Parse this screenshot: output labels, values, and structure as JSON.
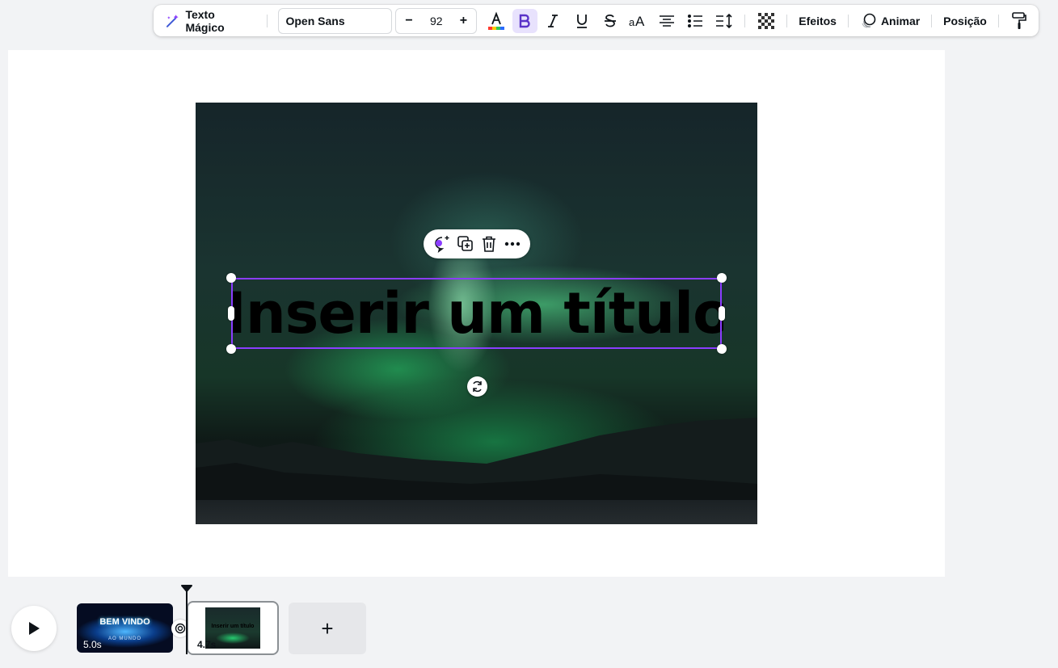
{
  "toolbar": {
    "magic_text_label": "Texto Mágico",
    "font_family_value": "Open Sans",
    "font_size_minus": "−",
    "font_size_value": "92",
    "font_size_plus": "+",
    "effects_label": "Efeitos",
    "animate_label": "Animar",
    "position_label": "Posição",
    "icons": [
      "magic-wand-icon",
      "text-color-icon",
      "bold-icon",
      "italic-icon",
      "underline-icon",
      "strikethrough-icon",
      "letter-case-icon",
      "align-center-icon",
      "list-icon",
      "spacing-icon",
      "transparency-icon",
      "animate-icon",
      "paint-roller-icon"
    ]
  },
  "canvas": {
    "title_text": "Inserir um título",
    "context_menu": [
      "magic-comment-icon",
      "duplicate-icon",
      "trash-icon",
      "more-icon"
    ]
  },
  "timeline": {
    "clips": [
      {
        "title": "BEM VINDO",
        "subtitle": "AO MUNDO",
        "duration": "5.0s"
      },
      {
        "title": "Inserir um título",
        "duration": "4.7s"
      }
    ],
    "add_page_label": "+"
  },
  "colors": {
    "accent": "#8b3dff",
    "active_bg": "#e8e2fd",
    "canvas_bg": "#f2f3f5"
  }
}
